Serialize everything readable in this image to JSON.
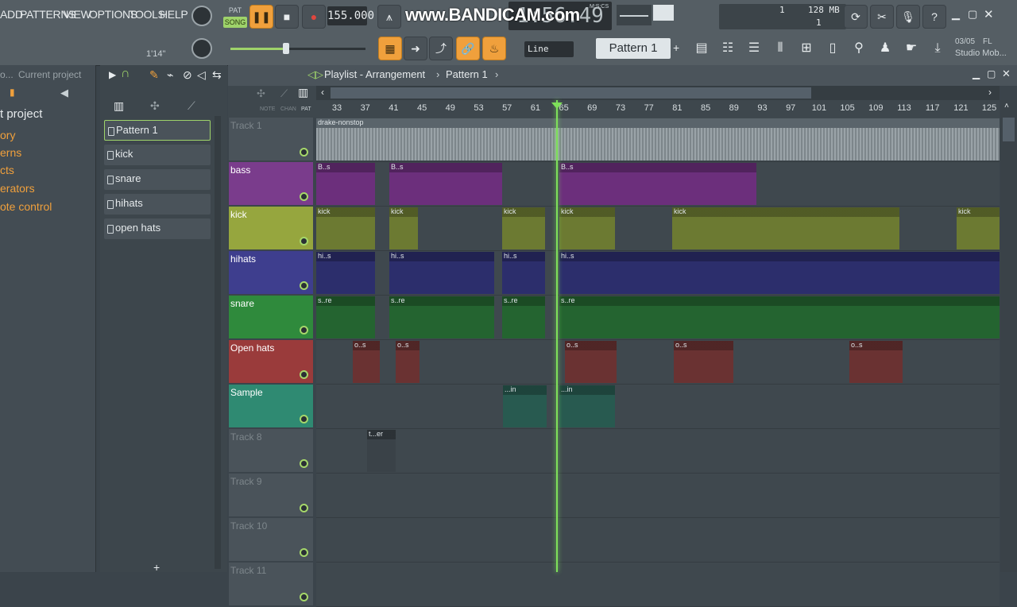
{
  "menu": [
    "ADD",
    "PATTERNS",
    "VIEW",
    "OPTIONS",
    "TOOLS",
    "HELP"
  ],
  "transport": {
    "pat_label": "PAT",
    "song_label": "SONG",
    "tempo": "155.000",
    "time": "1:56:49",
    "time_unit": "M:S:CS",
    "time_small": "1'14\""
  },
  "watermark": "www.BANDICAM.com",
  "cpu": {
    "value": "1",
    "memory": "128 MB",
    "poly": "1"
  },
  "snap": "Line",
  "pattern_selector": "Pattern 1",
  "news": {
    "date": "03/05",
    "brand": "FL",
    "text": "Studio Mob..."
  },
  "browser": {
    "tabs": [
      "o...",
      "Current project"
    ],
    "items": [
      "t project",
      "ory",
      "erns",
      "cts",
      "erators",
      "ote control"
    ]
  },
  "picker": {
    "patterns": [
      "Pattern 1",
      "kick",
      "snare",
      "hihats",
      "open hats"
    ]
  },
  "playlist": {
    "title": "Playlist - Arrangement",
    "crumb": "Pattern 1",
    "note_chan_pat": [
      "NOTE",
      "CHAN",
      "PAT"
    ],
    "ruler": [
      "33",
      "37",
      "41",
      "45",
      "49",
      "53",
      "57",
      "61",
      "65",
      "69",
      "73",
      "77",
      "81",
      "85",
      "89",
      "93",
      "97",
      "101",
      "105",
      "109",
      "113",
      "117",
      "121",
      "125"
    ],
    "tracks": [
      {
        "name": "Track 1",
        "color": "#4a535a",
        "text": "#7d868b"
      },
      {
        "name": "bass",
        "color": "#7a3c8c",
        "text": "#ffffff"
      },
      {
        "name": "kick",
        "color": "#96a63e",
        "text": "#ffffff"
      },
      {
        "name": "hihats",
        "color": "#3e3e8e",
        "text": "#ffffff"
      },
      {
        "name": "snare",
        "color": "#2f8a3c",
        "text": "#ffffff"
      },
      {
        "name": "Open hats",
        "color": "#9a3b3b",
        "text": "#ffffff"
      },
      {
        "name": "Sample",
        "color": "#2f8a72",
        "text": "#ffffff"
      },
      {
        "name": "Track 8",
        "color": "#4a535a",
        "text": "#7d868b"
      },
      {
        "name": "Track 9",
        "color": "#4a535a",
        "text": "#7d868b"
      },
      {
        "name": "Track 10",
        "color": "#4a535a",
        "text": "#7d868b"
      },
      {
        "name": "Track 11",
        "color": "#4a535a",
        "text": "#7d868b"
      }
    ],
    "audio_clip": "drake-nonstop",
    "clip_labels": {
      "bass": "B..s",
      "kick": "kick",
      "hihats": "hi..s",
      "snare": "s..re",
      "open": "o..s",
      "sample": "...in",
      "track8": "t...er"
    }
  }
}
